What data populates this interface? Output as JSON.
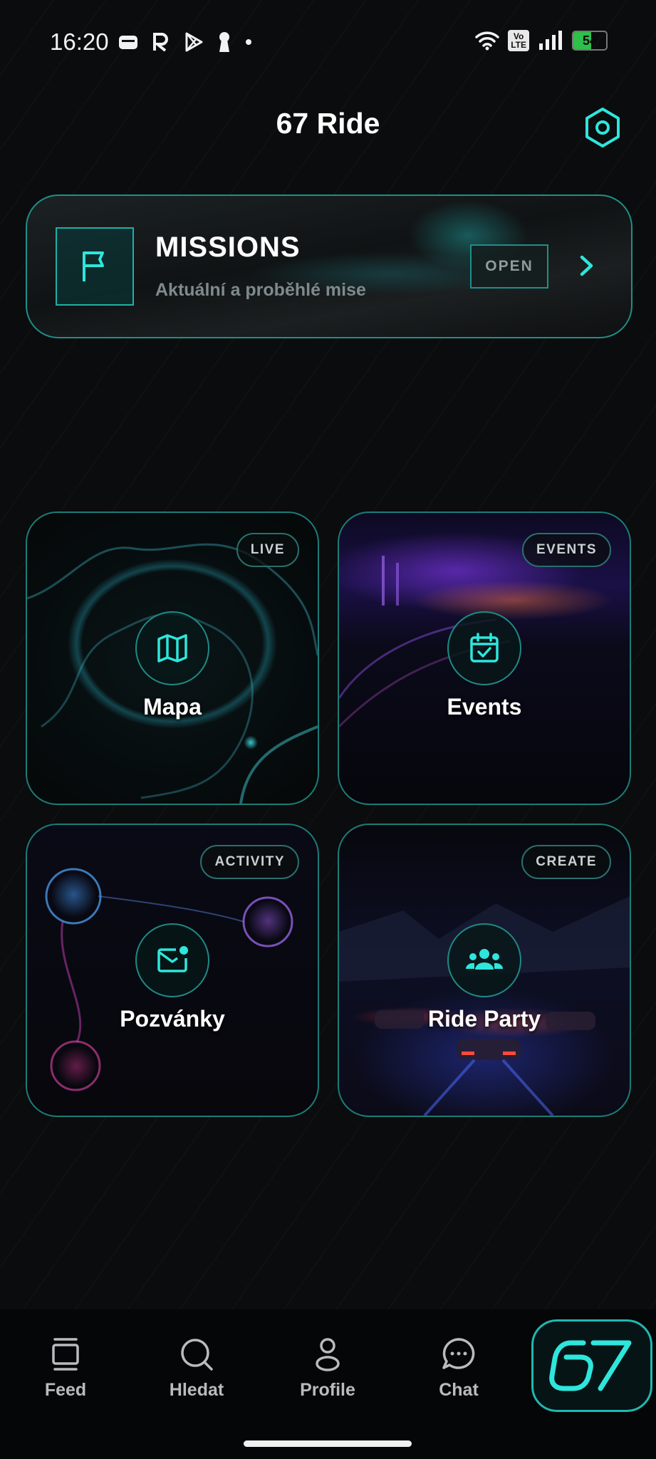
{
  "status_bar": {
    "time": "16:20",
    "battery": "54",
    "battery_level": 0.54,
    "lte": "Vo\nLTE"
  },
  "header": {
    "title": "67 Ride"
  },
  "missions": {
    "title": "MISSIONS",
    "subtitle": "Aktuální a proběhlé mise",
    "open_label": "OPEN"
  },
  "tiles": [
    {
      "badge": "LIVE",
      "label": "Mapa",
      "icon": "map-icon"
    },
    {
      "badge": "EVENTS",
      "label": "Events",
      "icon": "calendar-check-icon"
    },
    {
      "badge": "ACTIVITY",
      "label": "Pozvánky",
      "icon": "mail-notification-icon"
    },
    {
      "badge": "CREATE",
      "label": "Ride Party",
      "icon": "group-icon"
    }
  ],
  "nav": [
    {
      "label": "Feed",
      "icon": "feed-icon"
    },
    {
      "label": "Hledat",
      "icon": "search-icon"
    },
    {
      "label": "Profile",
      "icon": "profile-icon"
    },
    {
      "label": "Chat",
      "icon": "chat-icon"
    }
  ],
  "logo": {
    "icon": "67-logo-icon"
  },
  "colors": {
    "accent": "#2ee6dc",
    "border": "#1c7c78",
    "background": "#0b0c0d"
  }
}
